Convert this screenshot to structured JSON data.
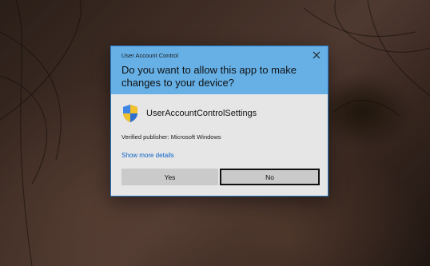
{
  "dialog": {
    "title": "User Account Control",
    "question": "Do you want to allow this app to make changes to your device?",
    "app_name": "UserAccountControlSettings",
    "publisher": "Verified publisher: Microsoft Windows",
    "more_details": "Show more details",
    "yes_label": "Yes",
    "no_label": "No"
  },
  "icons": {
    "close": "close-icon",
    "app": "uac-shield-icon"
  },
  "colors": {
    "header_blue": "#66b0e6",
    "body_gray": "#e6e6e6",
    "link_blue": "#0b63c9",
    "button_gray": "#cacaca"
  }
}
